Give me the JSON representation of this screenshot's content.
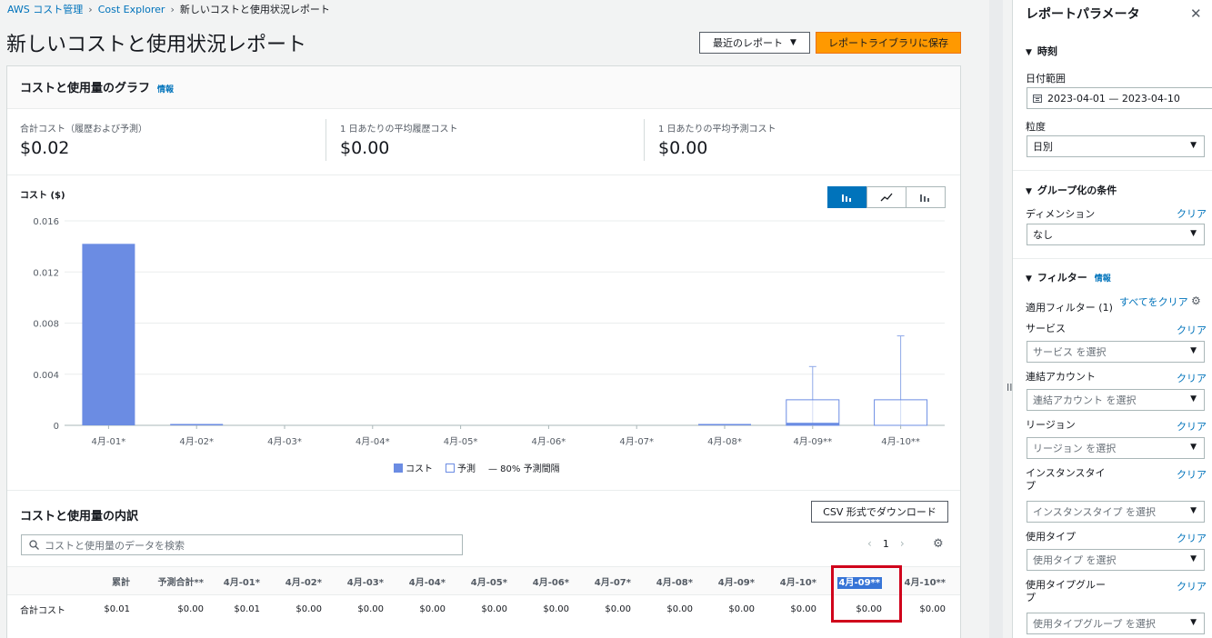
{
  "breadcrumb": {
    "items": [
      "AWS コスト管理",
      "Cost Explorer"
    ],
    "current": "新しいコストと使用状況レポート"
  },
  "page": {
    "title": "新しいコストと使用状況レポート",
    "recent_reports": "最近のレポート",
    "save_to_library": "レポートライブラリに保存"
  },
  "graph_panel": {
    "title": "コストと使用量のグラフ",
    "info": "情報",
    "metrics": [
      {
        "label": "合計コスト（履歴および予測）",
        "value": "$0.02"
      },
      {
        "label": "1 日あたりの平均履歴コスト",
        "value": "$0.00"
      },
      {
        "label": "1 日あたりの平均予測コスト",
        "value": "$0.00"
      }
    ],
    "cost_axis_title": "コスト ($)",
    "legend": {
      "cost": "コスト",
      "forecast": "予測",
      "interval": "— 80% 予測間隔"
    }
  },
  "chart_data": {
    "type": "bar",
    "ylabel": "コスト ($)",
    "ylim": [
      0,
      0.016
    ],
    "yticks": [
      "0.016",
      "0.012",
      "0.008",
      "0.004",
      "0"
    ],
    "yticks_values": [
      0.016,
      0.012,
      0.008,
      0.004,
      0
    ],
    "categories": [
      "4月-01*",
      "4月-02*",
      "4月-03*",
      "4月-04*",
      "4月-05*",
      "4月-06*",
      "4月-07*",
      "4月-08*",
      "4月-09**",
      "4月-10**"
    ],
    "series": [
      {
        "name": "コスト",
        "values": [
          0.0142,
          0.0001,
          0,
          0,
          0,
          0,
          0,
          0.0001,
          0.0002,
          0
        ]
      },
      {
        "name": "予測",
        "values": [
          0,
          0,
          0,
          0,
          0,
          0,
          0,
          0,
          0.002,
          0.002
        ]
      },
      {
        "name": "80% 予測間隔",
        "upper": [
          0,
          0,
          0,
          0,
          0,
          0,
          0,
          0,
          0.0046,
          0.007
        ]
      }
    ],
    "grid": true,
    "legend_position": "bottom"
  },
  "breakdown": {
    "title": "コストと使用量の内訳",
    "csv_button": "CSV 形式でダウンロード",
    "search_placeholder": "コストと使用量のデータを検索",
    "page_number": "1",
    "headers": [
      "",
      "累計",
      "予測合計**",
      "4月-01*",
      "4月-02*",
      "4月-03*",
      "4月-04*",
      "4月-05*",
      "4月-06*",
      "4月-07*",
      "4月-08*",
      "4月-09*",
      "4月-10*",
      "4月-09**",
      "4月-10**"
    ],
    "rows": [
      [
        "合計コスト",
        "$0.01",
        "$0.00",
        "$0.01",
        "$0.00",
        "$0.00",
        "$0.00",
        "$0.00",
        "$0.00",
        "$0.00",
        "$0.00",
        "$0.00",
        "$0.00",
        "$0.00",
        "$0.00"
      ]
    ]
  },
  "sidebar": {
    "title": "レポートパラメータ",
    "time_section": "時刻",
    "date_range_label": "日付範囲",
    "date_range_value": "2023-04-01 — 2023-04-10",
    "granularity_label": "粒度",
    "granularity_value": "日別",
    "group_section": "グループ化の条件",
    "dimension_label": "ディメンション",
    "clear": "クリア",
    "dimension_value": "なし",
    "filter_section": "フィルター",
    "filter_info": "情報",
    "applied_filters": "適用フィルター (1)",
    "clear_all": "すべてをクリア",
    "filters": [
      {
        "label": "サービス",
        "placeholder": "サービス を選択"
      },
      {
        "label": "連結アカウント",
        "placeholder": "連結アカウント を選択"
      },
      {
        "label": "リージョン",
        "placeholder": "リージョン を選択"
      },
      {
        "label": "インスタンスタイプ",
        "placeholder": "インスタンスタイプ を選択"
      },
      {
        "label": "使用タイプ",
        "placeholder": "使用タイプ を選択"
      },
      {
        "label": "使用タイプグループ",
        "placeholder": "使用タイプグループ を選択"
      }
    ]
  },
  "colors": {
    "accent": "#0073bb",
    "cost_bar": "#6b8ce3",
    "save_button": "#ff9900",
    "highlight_box": "#d0021b"
  }
}
